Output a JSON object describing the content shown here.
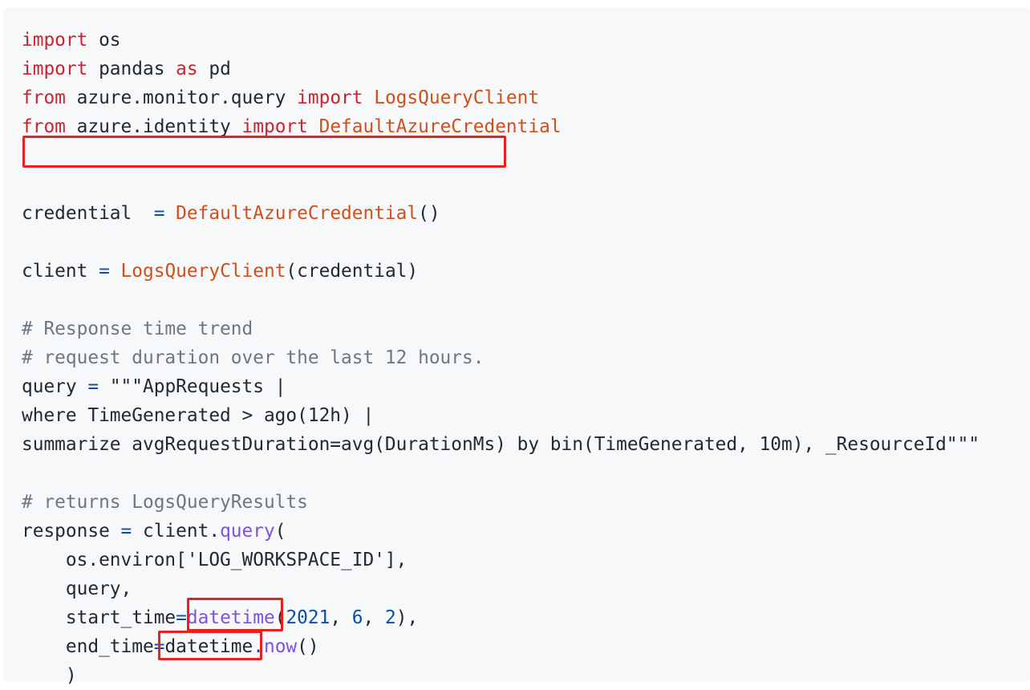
{
  "code": {
    "lines": [
      [
        {
          "t": "import",
          "c": "kw"
        },
        {
          "t": " os"
        }
      ],
      [
        {
          "t": "import",
          "c": "kw"
        },
        {
          "t": " pandas "
        },
        {
          "t": "as",
          "c": "kw"
        },
        {
          "t": " pd"
        }
      ],
      [
        {
          "t": "from",
          "c": "kw"
        },
        {
          "t": " azure.monitor.query "
        },
        {
          "t": "import",
          "c": "kw"
        },
        {
          "t": " "
        },
        {
          "t": "LogsQueryClient",
          "c": "fn"
        }
      ],
      [
        {
          "t": "from",
          "c": "kw"
        },
        {
          "t": " azure.identity "
        },
        {
          "t": "import",
          "c": "kw"
        },
        {
          "t": " "
        },
        {
          "t": "DefaultAzureCredential",
          "c": "fn"
        }
      ],
      [],
      [],
      [
        {
          "t": "credential  "
        },
        {
          "t": "=",
          "c": "op"
        },
        {
          "t": " "
        },
        {
          "t": "DefaultAzureCredential",
          "c": "fn"
        },
        {
          "t": "()"
        }
      ],
      [],
      [
        {
          "t": "client "
        },
        {
          "t": "=",
          "c": "op"
        },
        {
          "t": " "
        },
        {
          "t": "LogsQueryClient",
          "c": "fn"
        },
        {
          "t": "(credential)"
        }
      ],
      [],
      [
        {
          "t": "# Response time trend",
          "c": "com"
        }
      ],
      [
        {
          "t": "# request duration over the last 12 hours.",
          "c": "com"
        }
      ],
      [
        {
          "t": "query "
        },
        {
          "t": "=",
          "c": "op"
        },
        {
          "t": " \"\"\"AppRequests |"
        }
      ],
      [
        {
          "t": "where TimeGenerated > ago(12h) |"
        }
      ],
      [
        {
          "t": "summarize avgRequestDuration=avg(DurationMs) by bin(TimeGenerated, 10m), _ResourceId\"\"\""
        }
      ],
      [],
      [
        {
          "t": "# returns LogsQueryResults",
          "c": "com"
        }
      ],
      [
        {
          "t": "response "
        },
        {
          "t": "=",
          "c": "op"
        },
        {
          "t": " client."
        },
        {
          "t": "query",
          "c": "meth"
        },
        {
          "t": "("
        }
      ],
      [
        {
          "t": "    os.environ['LOG_WORKSPACE_ID'],"
        }
      ],
      [
        {
          "t": "    query,"
        }
      ],
      [
        {
          "t": "    start_time"
        },
        {
          "t": "=",
          "c": "op"
        },
        {
          "t": "datetime",
          "c": "meth"
        },
        {
          "t": "("
        },
        {
          "t": "2021",
          "c": "num"
        },
        {
          "t": ", "
        },
        {
          "t": "6",
          "c": "num"
        },
        {
          "t": ", "
        },
        {
          "t": "2",
          "c": "num"
        },
        {
          "t": "),"
        }
      ],
      [
        {
          "t": "    end_time"
        },
        {
          "t": "=",
          "c": "op"
        },
        {
          "t": "datetime"
        },
        {
          "t": ".",
          "c": "op"
        },
        {
          "t": "now",
          "c": "meth"
        },
        {
          "t": "()"
        }
      ],
      [
        {
          "t": "    )"
        }
      ]
    ]
  },
  "colors": {
    "background": "#f6f8fa",
    "keyword": "#cf222e",
    "function": "#d1501a",
    "operator": "#0550ae",
    "comment": "#6e7781",
    "method": "#8250df",
    "highlight_border": "#e8201e"
  }
}
